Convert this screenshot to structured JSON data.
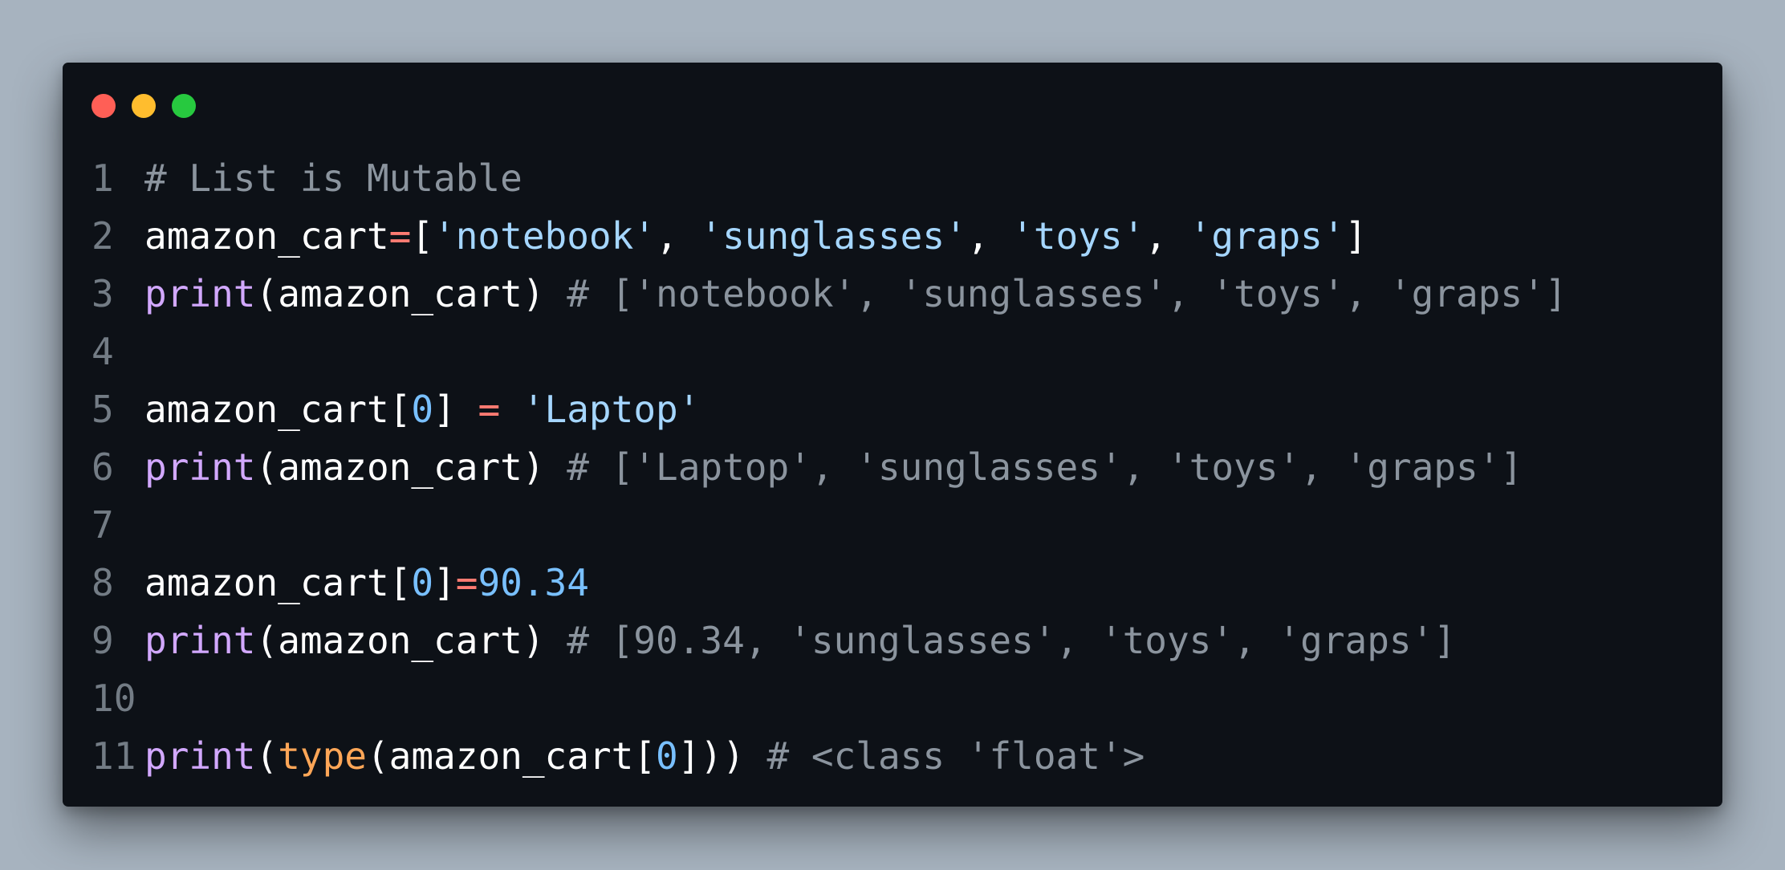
{
  "window": {
    "controls": [
      {
        "name": "close",
        "color": "#ff5f56"
      },
      {
        "name": "minimize",
        "color": "#ffbd2e"
      },
      {
        "name": "maximize",
        "color": "#27c93f"
      }
    ]
  },
  "code": {
    "language": "python",
    "lines": [
      {
        "number": "1",
        "tokens": [
          {
            "type": "comment",
            "text": "# List is Mutable"
          }
        ]
      },
      {
        "number": "2",
        "tokens": [
          {
            "type": "name",
            "text": "amazon_cart"
          },
          {
            "type": "op",
            "text": "="
          },
          {
            "type": "punct",
            "text": "["
          },
          {
            "type": "string",
            "text": "'notebook'"
          },
          {
            "type": "punct",
            "text": ", "
          },
          {
            "type": "string",
            "text": "'sunglasses'"
          },
          {
            "type": "punct",
            "text": ", "
          },
          {
            "type": "string",
            "text": "'toys'"
          },
          {
            "type": "punct",
            "text": ", "
          },
          {
            "type": "string",
            "text": "'graps'"
          },
          {
            "type": "punct",
            "text": "]"
          }
        ]
      },
      {
        "number": "3",
        "tokens": [
          {
            "type": "func",
            "text": "print"
          },
          {
            "type": "punct",
            "text": "("
          },
          {
            "type": "name",
            "text": "amazon_cart"
          },
          {
            "type": "punct",
            "text": ") "
          },
          {
            "type": "comment",
            "text": "# ['notebook', 'sunglasses', 'toys', 'graps']"
          }
        ]
      },
      {
        "number": "4",
        "tokens": []
      },
      {
        "number": "5",
        "tokens": [
          {
            "type": "name",
            "text": "amazon_cart"
          },
          {
            "type": "punct",
            "text": "["
          },
          {
            "type": "number",
            "text": "0"
          },
          {
            "type": "punct",
            "text": "] "
          },
          {
            "type": "op",
            "text": "="
          },
          {
            "type": "punct",
            "text": " "
          },
          {
            "type": "string",
            "text": "'Laptop'"
          }
        ]
      },
      {
        "number": "6",
        "tokens": [
          {
            "type": "func",
            "text": "print"
          },
          {
            "type": "punct",
            "text": "("
          },
          {
            "type": "name",
            "text": "amazon_cart"
          },
          {
            "type": "punct",
            "text": ") "
          },
          {
            "type": "comment",
            "text": "# ['Laptop', 'sunglasses', 'toys', 'graps']"
          }
        ]
      },
      {
        "number": "7",
        "tokens": []
      },
      {
        "number": "8",
        "tokens": [
          {
            "type": "name",
            "text": "amazon_cart"
          },
          {
            "type": "punct",
            "text": "["
          },
          {
            "type": "number",
            "text": "0"
          },
          {
            "type": "punct",
            "text": "]"
          },
          {
            "type": "op",
            "text": "="
          },
          {
            "type": "number",
            "text": "90.34"
          }
        ]
      },
      {
        "number": "9",
        "tokens": [
          {
            "type": "func",
            "text": "print"
          },
          {
            "type": "punct",
            "text": "("
          },
          {
            "type": "name",
            "text": "amazon_cart"
          },
          {
            "type": "punct",
            "text": ") "
          },
          {
            "type": "comment",
            "text": "# [90.34, 'sunglasses', 'toys', 'graps']"
          }
        ]
      },
      {
        "number": "10",
        "tokens": []
      },
      {
        "number": "11",
        "tokens": [
          {
            "type": "func",
            "text": "print"
          },
          {
            "type": "punct",
            "text": "("
          },
          {
            "type": "builtin",
            "text": "type"
          },
          {
            "type": "punct",
            "text": "("
          },
          {
            "type": "name",
            "text": "amazon_cart"
          },
          {
            "type": "punct",
            "text": "["
          },
          {
            "type": "number",
            "text": "0"
          },
          {
            "type": "punct",
            "text": "])) "
          },
          {
            "type": "comment",
            "text": "# <class 'float'>"
          }
        ]
      }
    ]
  }
}
